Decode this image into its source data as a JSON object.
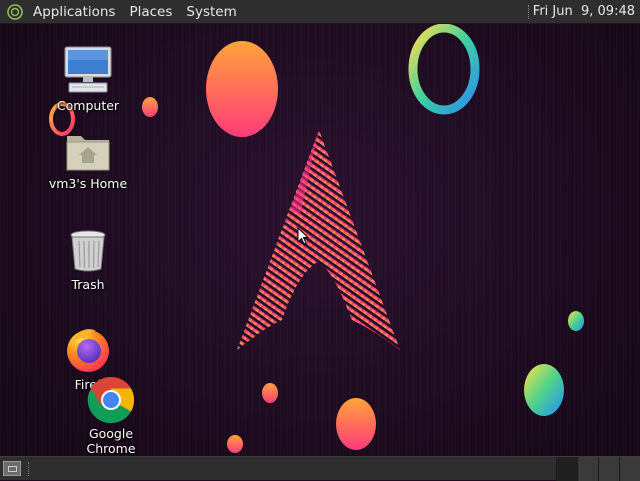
{
  "top_panel": {
    "menus": [
      "Applications",
      "Places",
      "System"
    ],
    "clock": "Fri Jun  9, 09:48"
  },
  "desktop_icons": [
    {
      "label": "Computer",
      "icon": "computer-icon"
    },
    {
      "label": "vm3's Home",
      "icon": "home-folder-icon"
    },
    {
      "label": "Trash",
      "icon": "trash-icon"
    },
    {
      "label": "Firef",
      "icon": "firefox-icon"
    },
    {
      "label": "Google Chrome",
      "icon": "chrome-icon"
    }
  ],
  "wallpaper": {
    "logo": "arch-linux-logo",
    "accent_colors": [
      "#ff2d8a",
      "#ff8a30",
      "#ffd23d",
      "#35c0e8",
      "#7ad36b"
    ]
  },
  "bottom_panel": {
    "show_desktop_icon": "show-desktop-icon",
    "workspace_count": 4,
    "active_workspace": 1
  }
}
